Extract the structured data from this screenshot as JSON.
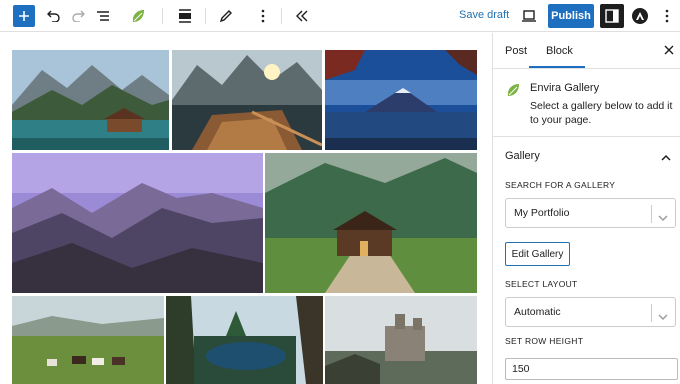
{
  "toolbar": {
    "save_draft": "Save draft",
    "publish": "Publish",
    "icons": [
      "plus-icon",
      "undo-icon",
      "redo-icon",
      "list-view-icon",
      "envira-leaf-icon",
      "align-icon",
      "edit-pen-icon",
      "more-options-icon",
      "collapse-icon",
      "desktop-preview-icon",
      "settings-icon",
      "astra-icon",
      "kebab-menu-icon"
    ],
    "accent": "#1e6fc0"
  },
  "gallery": {
    "photos": [
      "lake-mountains-boathouse",
      "mountain-lake-rowboat",
      "mount-fuji-lake",
      "purple-mountain-range",
      "forest-cabin-meadow",
      "cows-on-hill",
      "forest-lake-cliffs",
      "castle-ruins"
    ]
  },
  "sidebar": {
    "tabs": [
      "Post",
      "Block"
    ],
    "active_tab": "Block",
    "block": {
      "title": "Envira Gallery",
      "description": "Select a gallery below to add it to your page."
    },
    "panel": {
      "title": "Gallery",
      "search_label": "SEARCH FOR A GALLERY",
      "search_value": "My Portfolio",
      "edit_button": "Edit Gallery",
      "layout_label": "SELECT LAYOUT",
      "layout_value": "Automatic",
      "row_height_label": "SET ROW HEIGHT",
      "row_height_value": "150"
    }
  }
}
